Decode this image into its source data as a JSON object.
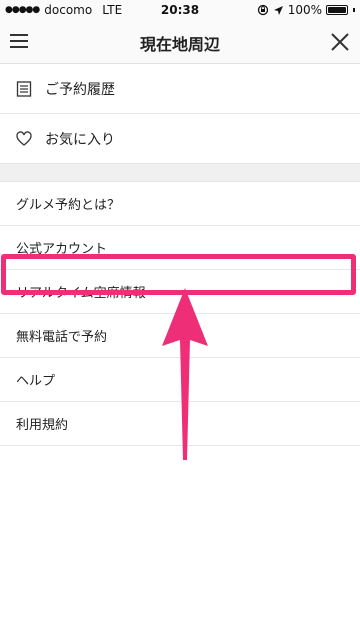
{
  "status_bar": {
    "signal": "●●●●●",
    "carrier": "docomo",
    "network": "LTE",
    "time": "20:38",
    "battery_percent": "100%",
    "battery_level": 1.0
  },
  "header": {
    "title": "現在地周辺",
    "menu_icon": "hamburger-icon",
    "close_icon": "close-icon"
  },
  "menu": {
    "icon_items": [
      {
        "label": "ご予約履歴",
        "icon": "list-icon"
      },
      {
        "label": "お気に入り",
        "icon": "heart-icon"
      }
    ],
    "text_items": [
      {
        "label": "グルメ予約とは？"
      },
      {
        "label": "公式アカウント"
      },
      {
        "label": "リアルタイム空席情報"
      },
      {
        "label": "無料電話で予約"
      },
      {
        "label": "ヘルプ"
      },
      {
        "label": "利用規約"
      }
    ]
  },
  "annotation": {
    "highlight_color": "#ee2f78",
    "arrow_color": "#ee2f78"
  }
}
